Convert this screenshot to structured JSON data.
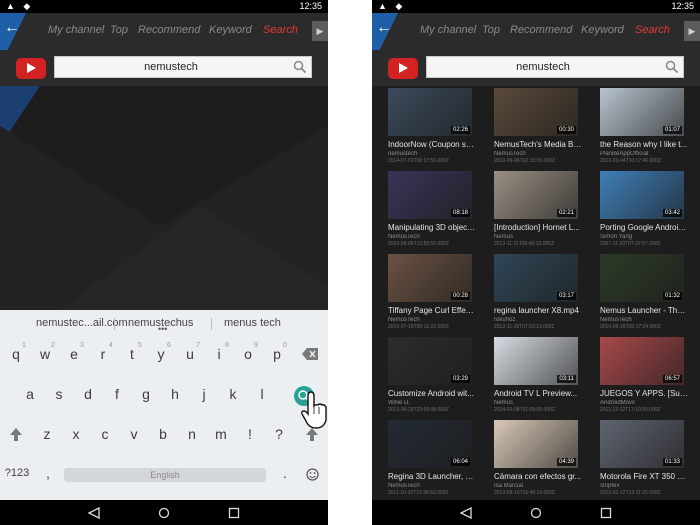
{
  "status": {
    "time": "12:35",
    "left_icons": "▲ ◆"
  },
  "nav": {
    "tabs": [
      "My channel",
      "Top",
      "Recommend",
      "Keyword",
      "Search"
    ],
    "active_tab": "Search"
  },
  "left_screen": {
    "search_value": "nemustech",
    "suggestions": [
      "nemustec...ail.com",
      "nemustechus",
      "menus tech"
    ],
    "keyboard": {
      "row1": [
        "q",
        "w",
        "e",
        "r",
        "t",
        "y",
        "u",
        "i",
        "o",
        "p"
      ],
      "row1_hints": [
        "1",
        "2",
        "3",
        "4",
        "5",
        "6",
        "7",
        "8",
        "9",
        "0"
      ],
      "row2": [
        "a",
        "s",
        "d",
        "f",
        "g",
        "h",
        "j",
        "k",
        "l"
      ],
      "row3": [
        "z",
        "x",
        "c",
        "v",
        "b",
        "n",
        "m",
        "!",
        "?"
      ],
      "symbols_key": "?123",
      "comma": ",",
      "period": ".",
      "space_label": "English"
    }
  },
  "right_screen": {
    "search_value": "nemustech",
    "results": [
      {
        "title": "IndoorNow (Coupon se...",
        "user": "nemustech",
        "date": "2014-07-01T06:17:56.000Z",
        "duration": "02:26",
        "color": "#3b4a5c"
      },
      {
        "title": "NemusTech's Media Br...",
        "user": "NemusTech",
        "date": "2010-09-06T02:15:05.000Z",
        "duration": "00:30",
        "color": "#5a4a3a"
      },
      {
        "title": "the Reason why I like t...",
        "user": "PlanBeAppOfficial",
        "date": "2013-03-04T10:17:46.000Z",
        "duration": "01:07",
        "color": "#b9c4cf"
      },
      {
        "title": "Manipulating 3D object...",
        "user": "NemusTech",
        "date": "2010-08-06T13:55:55.000Z",
        "duration": "08:18",
        "color": "#3a3356"
      },
      {
        "title": "[Introduction] Hornet L...",
        "user": "Nemus",
        "date": "2013-11-11T00:40:33.000Z",
        "duration": "02:21",
        "color": "#9a8f84"
      },
      {
        "title": "Porting Google Android...",
        "user": "Simon Yang",
        "date": "2007-11-20T07:37:57.000Z",
        "duration": "03:42",
        "color": "#3f7fb8"
      },
      {
        "title": "Tiffany Page Curl Effec...",
        "user": "NemusTech",
        "date": "2010-07-18T05:12:22.000Z",
        "duration": "00:28",
        "color": "#6a5242"
      },
      {
        "title": "regina launcher X8.mp4",
        "user": "rokuhoz",
        "date": "2013-11-28T07:53:13.000Z",
        "duration": "03:17",
        "color": "#2f4656"
      },
      {
        "title": "Nemus Launcher - The...",
        "user": "NemusTech",
        "date": "2010-06-18T05:17:24.000Z",
        "duration": "01:32",
        "color": "#2d3a28"
      },
      {
        "title": "Customize Android wit...",
        "user": "Willie D.",
        "date": "2013-06-29T23:09:08.000Z",
        "duration": "03:29",
        "color": "#2c2c2c"
      },
      {
        "title": "Android TV L Preview...",
        "user": "Nemus",
        "date": "2014-02-08T01:09:55.000Z",
        "duration": "03:11",
        "color": "#d7dde3"
      },
      {
        "title": "JUEGOS Y APPS. [Sug...",
        "user": "AndroidMovil",
        "date": "2011-12-12T17:10:20.000Z",
        "duration": "06:57",
        "color": "#a8494a"
      },
      {
        "title": "Regina 3D Launcher, wi...",
        "user": "NemusTech",
        "date": "2011-10-10T19:36:52.000Z",
        "duration": "06:04",
        "color": "#242a33"
      },
      {
        "title": "Cámara con efectos gr...",
        "user": "Isa Marcial",
        "date": "2013-08-19T16:46:19.000Z",
        "duration": "04:39",
        "color": "#d8c8b6"
      },
      {
        "title": "Motorola Fire XT 350 N...",
        "user": "stripfex",
        "date": "2012-02-12T13:11:25.000Z",
        "duration": "01:33",
        "color": "#5f6470"
      }
    ]
  },
  "colors": {
    "accent": "#e53935",
    "youtube_red": "#d32222",
    "nav_corner": "#1f5fa8"
  }
}
